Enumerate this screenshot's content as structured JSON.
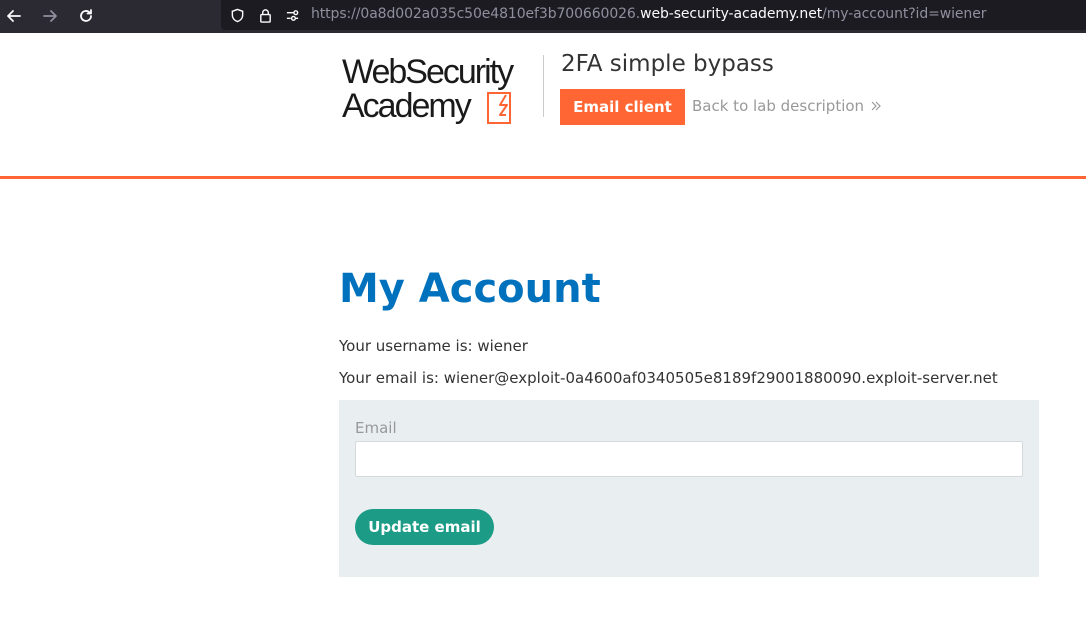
{
  "browser": {
    "url_prefix": "https://0a8d002a035c50e4810ef3b700660026.",
    "url_host": "web-security-academy.net",
    "url_path": "/my-account?id=wiener"
  },
  "header": {
    "logo_line1": "WebSecurity",
    "logo_line2": "Academy",
    "lab_title": "2FA simple bypass",
    "email_client_label": "Email client",
    "back_link_label": "Back to lab description"
  },
  "main": {
    "title": "My Account",
    "username_line": "Your username is: wiener",
    "email_line": "Your email is: wiener@exploit-0a4600af0340505e8189f29001880090.exploit-server.net",
    "form": {
      "email_label": "Email",
      "email_value": "",
      "submit_label": "Update email"
    }
  },
  "colors": {
    "accent_orange": "#ff6633",
    "title_blue": "#0071bc",
    "button_green": "#1c9c86",
    "panel_bg": "#e9eef0"
  }
}
